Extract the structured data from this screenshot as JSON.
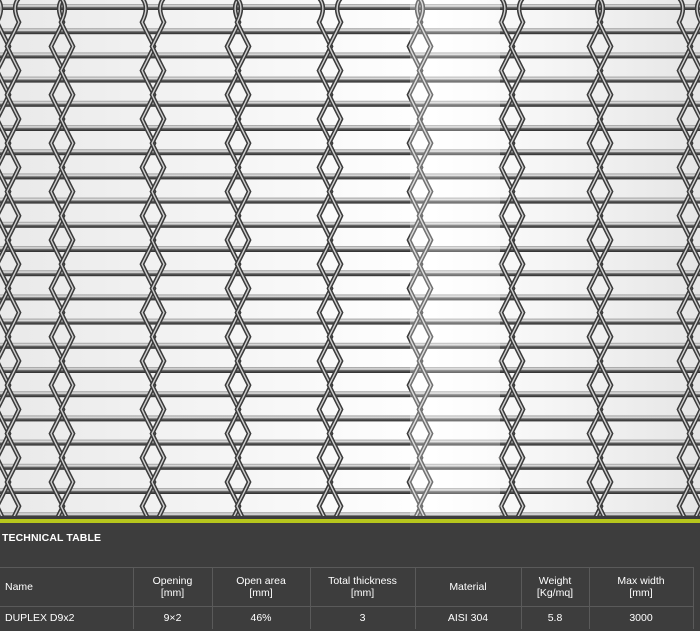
{
  "technical_table": {
    "title": "TECHNICAL TABLE",
    "columns": [
      {
        "label": "Name",
        "unit": ""
      },
      {
        "label": "Opening",
        "unit": "[mm]"
      },
      {
        "label": "Open area",
        "unit": "[mm]"
      },
      {
        "label": "Total thickness",
        "unit": "[mm]"
      },
      {
        "label": "Material",
        "unit": ""
      },
      {
        "label": "Weight",
        "unit": "[Kg/mq]"
      },
      {
        "label": "Max width",
        "unit": "[mm]"
      }
    ],
    "rows": [
      [
        "DUPLEX D9x2",
        "9×2",
        "46%",
        "3",
        "AISI 304",
        "5.8",
        "3000"
      ]
    ]
  },
  "colors": {
    "accent": "#b6c61c",
    "panel_background": "#3d3d3d",
    "text": "#ffffff"
  }
}
